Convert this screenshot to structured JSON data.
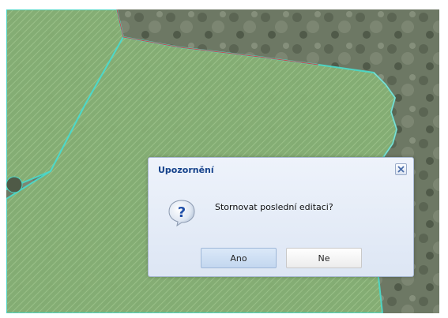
{
  "dialog": {
    "title": "Upozornění",
    "message": "Stornovat poslední editaci?",
    "yes_label": "Ano",
    "no_label": "Ne",
    "close_icon": "close-icon",
    "message_icon": "question-icon"
  },
  "colors": {
    "title": "#15428b",
    "polygon_fill": "#7fb070",
    "polygon_edge": "#4dd9c9",
    "parcel_line": "#c94b4b"
  }
}
